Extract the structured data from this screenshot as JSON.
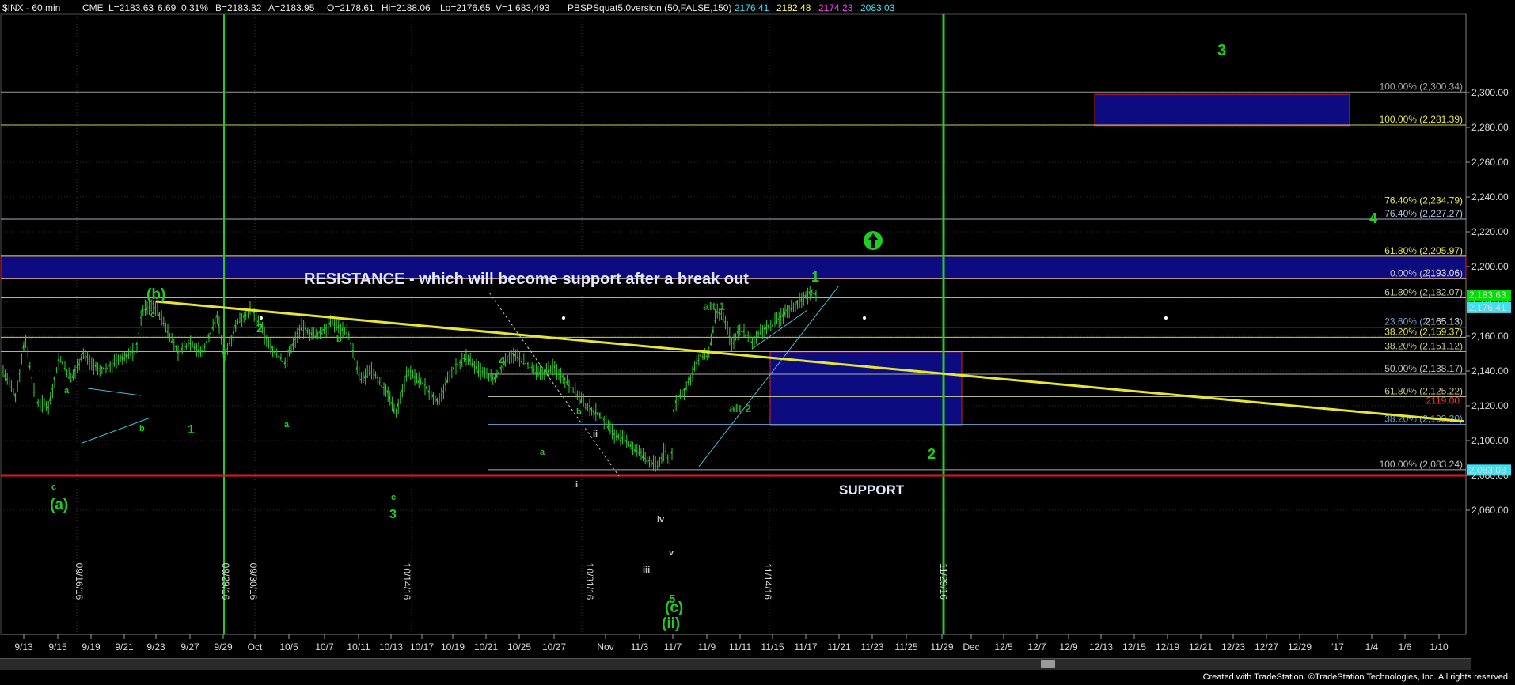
{
  "header": {
    "symbol": "$INX - 60 min",
    "exchange": "CME",
    "last": "L=2183.63",
    "change": "6.69",
    "change_pct": "0.31%",
    "bid": "B=2183.32",
    "ask": "A=2183.95",
    "open": "O=2178.61",
    "high": "Hi=2188.06",
    "low": "Lo=2176.65",
    "volume": "V=1,683,493",
    "indicator": "PBSPSquat5.0version (50,FALSE,150)",
    "ind_values": [
      {
        "text": "2176.41",
        "color": "#40e0f0"
      },
      {
        "text": "2182.48",
        "color": "#ffff60"
      },
      {
        "text": "2174.23",
        "color": "#ff40ff"
      },
      {
        "text": "2083.03",
        "color": "#40e0f0"
      }
    ]
  },
  "chart_data": {
    "type": "candlestick",
    "title": "$INX - 60 min",
    "ylim": [
      2050,
      2306
    ],
    "y_ticks": [
      "2,060.00",
      "2,080.00",
      "2,100.00",
      "2,120.00",
      "2,140.00",
      "2,160.00",
      "2,180.00",
      "2,200.00",
      "2,220.00",
      "2,240.00",
      "2,260.00",
      "2,280.00",
      "2,300.00"
    ],
    "x_ticks": [
      "9/13",
      "9/15",
      "9/19",
      "9/21",
      "9/23",
      "9/27",
      "9/29",
      "Oct",
      "10/5",
      "10/7",
      "10/11",
      "10/13",
      "10/17",
      "10/19",
      "10/21",
      "10/25",
      "10/27",
      "Nov",
      "11/3",
      "11/7",
      "11/9",
      "11/11",
      "11/15",
      "11/17",
      "11/21",
      "11/23",
      "11/25",
      "11/29",
      "Dec",
      "12/5",
      "12/7",
      "12/9",
      "12/13",
      "12/15",
      "12/19",
      "12/21",
      "12/23",
      "12/27",
      "12/29",
      "'17",
      "1/4",
      "1/6",
      "1/10"
    ],
    "vertical_date_labels": [
      {
        "text": "09/16/16",
        "color": "#c8c8c8"
      },
      {
        "text": "09/29/16",
        "color": "#3cd23c"
      },
      {
        "text": "09/30/16",
        "color": "#c8c8c8"
      },
      {
        "text": "10/14/16",
        "color": "#c8c8c8"
      },
      {
        "text": "10/31/16",
        "color": "#c8c8c8"
      },
      {
        "text": "11/14/16",
        "color": "#c8c8c8"
      },
      {
        "text": "11/29/16",
        "color": "#3cd23c"
      }
    ],
    "fib_levels": [
      {
        "label": "100.00% (2,300.34)",
        "value": 2300.34,
        "color": "#a8a8a8"
      },
      {
        "label": "100.00% (2,281.39)",
        "value": 2281.39,
        "color": "#e6e650"
      },
      {
        "label": "76.40% (2,234.79)",
        "value": 2234.79,
        "color": "#e6e650"
      },
      {
        "label": "76.40% (2,227.27)",
        "value": 2227.27,
        "color": "#b0c4de"
      },
      {
        "label": "61.80% (2,205.97)",
        "value": 2205.97,
        "color": "#e6e650"
      },
      {
        "label": "0.00% (2,193.06)",
        "value": 2193.06,
        "color": "#c0c0c0"
      },
      {
        "label": "61.80% (2,182.07)",
        "value": 2182.07,
        "color": "#c8c890"
      },
      {
        "label": "23.60% (2,165.13)",
        "value": 2165.13,
        "color": "#70a0d0"
      },
      {
        "label": "38.20% (2,159.37)",
        "value": 2159.37,
        "color": "#e6e650"
      },
      {
        "label": "38.20% (2,151.12)",
        "value": 2151.12,
        "color": "#c8c890"
      },
      {
        "label": "50.00% (2,138.17)",
        "value": 2138.17,
        "color": "#c0c0c0"
      },
      {
        "label": "61.80% (2,125.22)",
        "value": 2125.22,
        "color": "#c8c890"
      },
      {
        "label": "38.20% (2,109.30)",
        "value": 2109.3,
        "color": "#70a0d0"
      },
      {
        "label": "100.00% (2,083.24)",
        "value": 2083.24,
        "color": "#c0c0c0"
      }
    ],
    "extra_price_labels": [
      {
        "text": "2193.06",
        "value": 2194.5,
        "color": "#c0c0c0"
      },
      {
        "text": "2165.13",
        "value": 2166.5,
        "color": "#d0d0d0"
      },
      {
        "text": "2119.00",
        "value": 2121.2,
        "color": "#ff3030"
      }
    ],
    "price_tags": [
      {
        "text": "2,183.63",
        "value": 2183.63,
        "bg": "#00e000",
        "fg": "#000000"
      },
      {
        "text": "2,176.41",
        "value": 2176.41,
        "bg": "#40e0f0",
        "fg": "#000000"
      },
      {
        "text": "2,083.03",
        "value": 2083.03,
        "bg": "#40e0f0",
        "fg": "#000000"
      }
    ],
    "zones": [
      {
        "name": "resistance",
        "label": "RESISTANCE - which will become support after a break out",
        "y_top": 2206,
        "y_bottom": 2193,
        "x_start_date": "9/13",
        "x_end_date": "1/10"
      },
      {
        "name": "support",
        "label": "SUPPORT",
        "y_top": 2151,
        "y_bottom": 2109,
        "x_start_date": "11/15",
        "x_end_date": "11/29"
      },
      {
        "name": "target-3",
        "label": "3",
        "y_top": 2299,
        "y_bottom": 2281,
        "x_start_date": "12/13",
        "x_end_date": "12/21"
      }
    ],
    "trendline": {
      "from": {
        "date": "9/23",
        "y": 2180
      },
      "to": {
        "date": "1/10",
        "y": 2111
      },
      "color": "#e6e632"
    },
    "support_line_value": 2119.0,
    "wave_labels_large": [
      "(a)",
      "(b)",
      "1",
      "2",
      "3",
      "4",
      "(c)",
      "(ii)",
      "1",
      "2",
      "3",
      "4",
      "5"
    ],
    "wave_labels_small": [
      "a",
      "b",
      "c",
      "a",
      "b",
      "c",
      "a",
      "b",
      "c",
      "i",
      "ii",
      "iii",
      "iv",
      "v",
      "alt 1",
      "alt 2",
      "2"
    ]
  },
  "footer": "Created with TradeStation. ©TradeStation Technologies, Inc. All rights reserved."
}
